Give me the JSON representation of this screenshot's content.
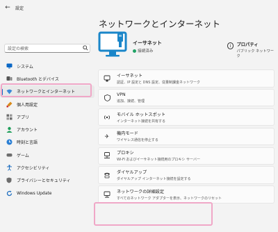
{
  "titlebar": {
    "back_icon": "arrow-left-icon",
    "title": "設定"
  },
  "search": {
    "placeholder": "設定の検索",
    "icon": "search-icon"
  },
  "nav": [
    {
      "label": "システム",
      "icon": "monitor-icon",
      "color": "#0a67c5"
    },
    {
      "label": "Bluetooth とデバイス",
      "icon": "bluetooth-devices-icon",
      "color": "#555555"
    },
    {
      "label": "ネットワークとインターネット",
      "icon": "wifi-network-icon",
      "color": "#3a88d8",
      "selected": true
    },
    {
      "label": "個人用設定",
      "icon": "brush-icon",
      "color": "#d98a1a"
    },
    {
      "label": "アプリ",
      "icon": "apps-icon",
      "color": "#6d6d6d"
    },
    {
      "label": "アカウント",
      "icon": "account-icon",
      "color": "#1e9e5a"
    },
    {
      "label": "時刻と言語",
      "icon": "time-language-icon",
      "color": "#2a7fd4"
    },
    {
      "label": "ゲーム",
      "icon": "game-icon",
      "color": "#6d6d6d"
    },
    {
      "label": "アクセシビリティ",
      "icon": "accessibility-icon",
      "color": "#1f6fc0"
    },
    {
      "label": "プライバシーとセキュリティ",
      "icon": "shield-icon",
      "color": "#6d6d6d"
    },
    {
      "label": "Windows Update",
      "icon": "windows-update-icon",
      "color": "#1f6fc0"
    }
  ],
  "page": {
    "title": "ネットワークとインターネット"
  },
  "hero": {
    "name": "イーサネット",
    "status": "接続済み",
    "property_title": "プロパティ",
    "property_sub": "パブリック ネットワーク"
  },
  "cards": [
    {
      "icon": "ethernet-icon",
      "title": "イーサネット",
      "sub": "認証、IP 設定と DNS 設定、従量制課金ネットワーク"
    },
    {
      "icon": "vpn-shield-icon",
      "title": "VPN",
      "sub": "追加、接続、管理"
    },
    {
      "icon": "hotspot-icon",
      "title": "モバイル ホットスポット",
      "sub": "インターネット接続を共有する"
    },
    {
      "icon": "airplane-icon",
      "title": "機内モード",
      "sub": "ワイヤレス通信を停止する"
    },
    {
      "icon": "proxy-icon",
      "title": "プロキシ",
      "sub": "Wi-Fi およびイーサネット接続用のプロキシ サーバー"
    },
    {
      "icon": "dialup-icon",
      "title": "ダイヤルアップ",
      "sub": "ダイヤルアップ インターネット接続を設定する"
    },
    {
      "icon": "advanced-network-icon",
      "title": "ネットワークの詳細設定",
      "sub": "すべてのネットワーク アダプターを表示、ネットワークのリセット"
    }
  ]
}
